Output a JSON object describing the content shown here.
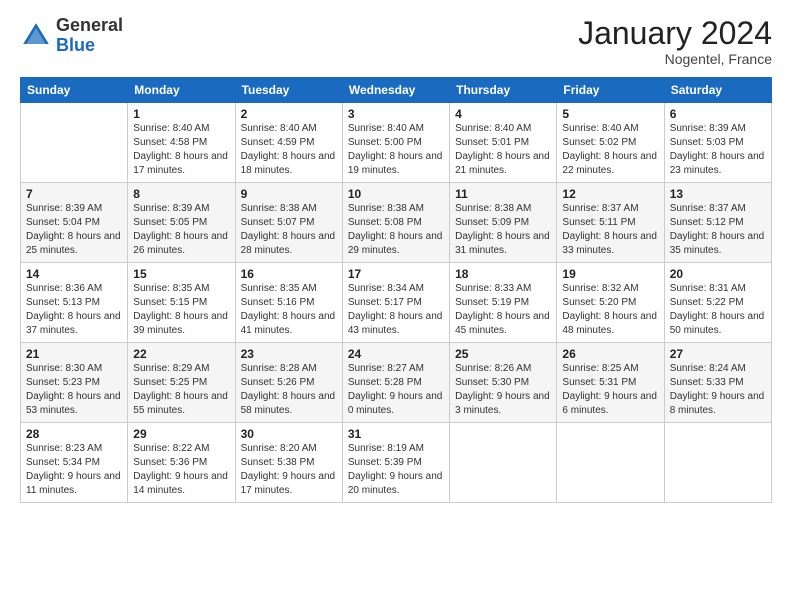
{
  "header": {
    "logo_general": "General",
    "logo_blue": "Blue",
    "month_title": "January 2024",
    "location": "Nogentel, France"
  },
  "weekdays": [
    "Sunday",
    "Monday",
    "Tuesday",
    "Wednesday",
    "Thursday",
    "Friday",
    "Saturday"
  ],
  "weeks": [
    [
      {
        "day": "",
        "sunrise": "",
        "sunset": "",
        "daylight": ""
      },
      {
        "day": "1",
        "sunrise": "Sunrise: 8:40 AM",
        "sunset": "Sunset: 4:58 PM",
        "daylight": "Daylight: 8 hours and 17 minutes."
      },
      {
        "day": "2",
        "sunrise": "Sunrise: 8:40 AM",
        "sunset": "Sunset: 4:59 PM",
        "daylight": "Daylight: 8 hours and 18 minutes."
      },
      {
        "day": "3",
        "sunrise": "Sunrise: 8:40 AM",
        "sunset": "Sunset: 5:00 PM",
        "daylight": "Daylight: 8 hours and 19 minutes."
      },
      {
        "day": "4",
        "sunrise": "Sunrise: 8:40 AM",
        "sunset": "Sunset: 5:01 PM",
        "daylight": "Daylight: 8 hours and 21 minutes."
      },
      {
        "day": "5",
        "sunrise": "Sunrise: 8:40 AM",
        "sunset": "Sunset: 5:02 PM",
        "daylight": "Daylight: 8 hours and 22 minutes."
      },
      {
        "day": "6",
        "sunrise": "Sunrise: 8:39 AM",
        "sunset": "Sunset: 5:03 PM",
        "daylight": "Daylight: 8 hours and 23 minutes."
      }
    ],
    [
      {
        "day": "7",
        "sunrise": "Sunrise: 8:39 AM",
        "sunset": "Sunset: 5:04 PM",
        "daylight": "Daylight: 8 hours and 25 minutes."
      },
      {
        "day": "8",
        "sunrise": "Sunrise: 8:39 AM",
        "sunset": "Sunset: 5:05 PM",
        "daylight": "Daylight: 8 hours and 26 minutes."
      },
      {
        "day": "9",
        "sunrise": "Sunrise: 8:38 AM",
        "sunset": "Sunset: 5:07 PM",
        "daylight": "Daylight: 8 hours and 28 minutes."
      },
      {
        "day": "10",
        "sunrise": "Sunrise: 8:38 AM",
        "sunset": "Sunset: 5:08 PM",
        "daylight": "Daylight: 8 hours and 29 minutes."
      },
      {
        "day": "11",
        "sunrise": "Sunrise: 8:38 AM",
        "sunset": "Sunset: 5:09 PM",
        "daylight": "Daylight: 8 hours and 31 minutes."
      },
      {
        "day": "12",
        "sunrise": "Sunrise: 8:37 AM",
        "sunset": "Sunset: 5:11 PM",
        "daylight": "Daylight: 8 hours and 33 minutes."
      },
      {
        "day": "13",
        "sunrise": "Sunrise: 8:37 AM",
        "sunset": "Sunset: 5:12 PM",
        "daylight": "Daylight: 8 hours and 35 minutes."
      }
    ],
    [
      {
        "day": "14",
        "sunrise": "Sunrise: 8:36 AM",
        "sunset": "Sunset: 5:13 PM",
        "daylight": "Daylight: 8 hours and 37 minutes."
      },
      {
        "day": "15",
        "sunrise": "Sunrise: 8:35 AM",
        "sunset": "Sunset: 5:15 PM",
        "daylight": "Daylight: 8 hours and 39 minutes."
      },
      {
        "day": "16",
        "sunrise": "Sunrise: 8:35 AM",
        "sunset": "Sunset: 5:16 PM",
        "daylight": "Daylight: 8 hours and 41 minutes."
      },
      {
        "day": "17",
        "sunrise": "Sunrise: 8:34 AM",
        "sunset": "Sunset: 5:17 PM",
        "daylight": "Daylight: 8 hours and 43 minutes."
      },
      {
        "day": "18",
        "sunrise": "Sunrise: 8:33 AM",
        "sunset": "Sunset: 5:19 PM",
        "daylight": "Daylight: 8 hours and 45 minutes."
      },
      {
        "day": "19",
        "sunrise": "Sunrise: 8:32 AM",
        "sunset": "Sunset: 5:20 PM",
        "daylight": "Daylight: 8 hours and 48 minutes."
      },
      {
        "day": "20",
        "sunrise": "Sunrise: 8:31 AM",
        "sunset": "Sunset: 5:22 PM",
        "daylight": "Daylight: 8 hours and 50 minutes."
      }
    ],
    [
      {
        "day": "21",
        "sunrise": "Sunrise: 8:30 AM",
        "sunset": "Sunset: 5:23 PM",
        "daylight": "Daylight: 8 hours and 53 minutes."
      },
      {
        "day": "22",
        "sunrise": "Sunrise: 8:29 AM",
        "sunset": "Sunset: 5:25 PM",
        "daylight": "Daylight: 8 hours and 55 minutes."
      },
      {
        "day": "23",
        "sunrise": "Sunrise: 8:28 AM",
        "sunset": "Sunset: 5:26 PM",
        "daylight": "Daylight: 8 hours and 58 minutes."
      },
      {
        "day": "24",
        "sunrise": "Sunrise: 8:27 AM",
        "sunset": "Sunset: 5:28 PM",
        "daylight": "Daylight: 9 hours and 0 minutes."
      },
      {
        "day": "25",
        "sunrise": "Sunrise: 8:26 AM",
        "sunset": "Sunset: 5:30 PM",
        "daylight": "Daylight: 9 hours and 3 minutes."
      },
      {
        "day": "26",
        "sunrise": "Sunrise: 8:25 AM",
        "sunset": "Sunset: 5:31 PM",
        "daylight": "Daylight: 9 hours and 6 minutes."
      },
      {
        "day": "27",
        "sunrise": "Sunrise: 8:24 AM",
        "sunset": "Sunset: 5:33 PM",
        "daylight": "Daylight: 9 hours and 8 minutes."
      }
    ],
    [
      {
        "day": "28",
        "sunrise": "Sunrise: 8:23 AM",
        "sunset": "Sunset: 5:34 PM",
        "daylight": "Daylight: 9 hours and 11 minutes."
      },
      {
        "day": "29",
        "sunrise": "Sunrise: 8:22 AM",
        "sunset": "Sunset: 5:36 PM",
        "daylight": "Daylight: 9 hours and 14 minutes."
      },
      {
        "day": "30",
        "sunrise": "Sunrise: 8:20 AM",
        "sunset": "Sunset: 5:38 PM",
        "daylight": "Daylight: 9 hours and 17 minutes."
      },
      {
        "day": "31",
        "sunrise": "Sunrise: 8:19 AM",
        "sunset": "Sunset: 5:39 PM",
        "daylight": "Daylight: 9 hours and 20 minutes."
      },
      {
        "day": "",
        "sunrise": "",
        "sunset": "",
        "daylight": ""
      },
      {
        "day": "",
        "sunrise": "",
        "sunset": "",
        "daylight": ""
      },
      {
        "day": "",
        "sunrise": "",
        "sunset": "",
        "daylight": ""
      }
    ]
  ]
}
